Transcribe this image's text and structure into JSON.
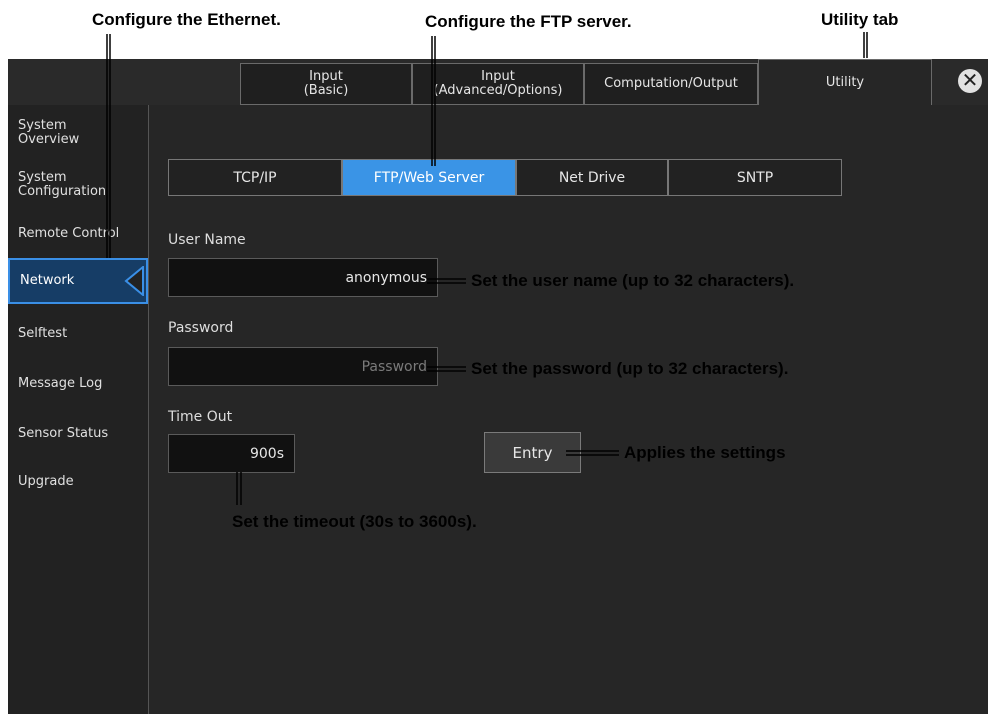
{
  "callouts": {
    "ethernet": "Configure the Ethernet.",
    "ftp": "Configure the FTP server.",
    "utility_tab": "Utility tab",
    "user_name": "Set the user name (up to 32 characters).",
    "password": "Set the password (up to 32 characters).",
    "entry": "Applies the settings",
    "timeout": "Set the timeout (30s to 3600s)."
  },
  "tabs": [
    {
      "line1": "Input",
      "line2": "(Basic)"
    },
    {
      "line1": "Input",
      "line2": "(Advanced/Options)"
    },
    {
      "line1": "Computation/Output",
      "line2": ""
    },
    {
      "line1": "Utility",
      "line2": ""
    }
  ],
  "sidebar": {
    "items": [
      {
        "line1": "System",
        "line2": "Overview"
      },
      {
        "line1": "System",
        "line2": "Configuration"
      },
      {
        "line1": "Remote Control",
        "line2": ""
      },
      {
        "line1": "Network",
        "line2": ""
      },
      {
        "line1": "Selftest",
        "line2": ""
      },
      {
        "line1": "Message Log",
        "line2": ""
      },
      {
        "line1": "Sensor Status",
        "line2": ""
      },
      {
        "line1": "Upgrade",
        "line2": ""
      }
    ]
  },
  "subtabs": [
    "TCP/IP",
    "FTP/Web Server",
    "Net Drive",
    "SNTP"
  ],
  "form": {
    "user_name_label": "User Name",
    "user_name_value": "anonymous",
    "password_label": "Password",
    "password_placeholder": "Password",
    "timeout_label": "Time Out",
    "timeout_value": "900s",
    "entry_label": "Entry"
  },
  "colors": {
    "active_subtab": "#3a94e6",
    "active_sidebar_border": "#3a8fe6",
    "background": "#222222"
  },
  "icons": {
    "close": "close-icon"
  }
}
